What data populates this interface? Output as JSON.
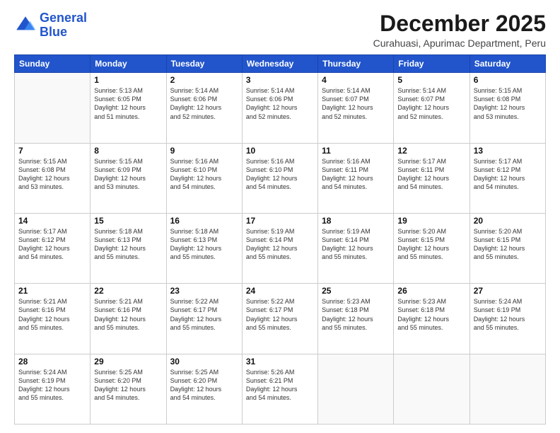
{
  "logo": {
    "line1": "General",
    "line2": "Blue"
  },
  "header": {
    "month_title": "December 2025",
    "subtitle": "Curahuasi, Apurimac Department, Peru"
  },
  "weekdays": [
    "Sunday",
    "Monday",
    "Tuesday",
    "Wednesday",
    "Thursday",
    "Friday",
    "Saturday"
  ],
  "weeks": [
    [
      {
        "day": "",
        "info": ""
      },
      {
        "day": "1",
        "info": "Sunrise: 5:13 AM\nSunset: 6:05 PM\nDaylight: 12 hours\nand 51 minutes."
      },
      {
        "day": "2",
        "info": "Sunrise: 5:14 AM\nSunset: 6:06 PM\nDaylight: 12 hours\nand 52 minutes."
      },
      {
        "day": "3",
        "info": "Sunrise: 5:14 AM\nSunset: 6:06 PM\nDaylight: 12 hours\nand 52 minutes."
      },
      {
        "day": "4",
        "info": "Sunrise: 5:14 AM\nSunset: 6:07 PM\nDaylight: 12 hours\nand 52 minutes."
      },
      {
        "day": "5",
        "info": "Sunrise: 5:14 AM\nSunset: 6:07 PM\nDaylight: 12 hours\nand 52 minutes."
      },
      {
        "day": "6",
        "info": "Sunrise: 5:15 AM\nSunset: 6:08 PM\nDaylight: 12 hours\nand 53 minutes."
      }
    ],
    [
      {
        "day": "7",
        "info": "Sunrise: 5:15 AM\nSunset: 6:08 PM\nDaylight: 12 hours\nand 53 minutes."
      },
      {
        "day": "8",
        "info": "Sunrise: 5:15 AM\nSunset: 6:09 PM\nDaylight: 12 hours\nand 53 minutes."
      },
      {
        "day": "9",
        "info": "Sunrise: 5:16 AM\nSunset: 6:10 PM\nDaylight: 12 hours\nand 54 minutes."
      },
      {
        "day": "10",
        "info": "Sunrise: 5:16 AM\nSunset: 6:10 PM\nDaylight: 12 hours\nand 54 minutes."
      },
      {
        "day": "11",
        "info": "Sunrise: 5:16 AM\nSunset: 6:11 PM\nDaylight: 12 hours\nand 54 minutes."
      },
      {
        "day": "12",
        "info": "Sunrise: 5:17 AM\nSunset: 6:11 PM\nDaylight: 12 hours\nand 54 minutes."
      },
      {
        "day": "13",
        "info": "Sunrise: 5:17 AM\nSunset: 6:12 PM\nDaylight: 12 hours\nand 54 minutes."
      }
    ],
    [
      {
        "day": "14",
        "info": "Sunrise: 5:17 AM\nSunset: 6:12 PM\nDaylight: 12 hours\nand 54 minutes."
      },
      {
        "day": "15",
        "info": "Sunrise: 5:18 AM\nSunset: 6:13 PM\nDaylight: 12 hours\nand 55 minutes."
      },
      {
        "day": "16",
        "info": "Sunrise: 5:18 AM\nSunset: 6:13 PM\nDaylight: 12 hours\nand 55 minutes."
      },
      {
        "day": "17",
        "info": "Sunrise: 5:19 AM\nSunset: 6:14 PM\nDaylight: 12 hours\nand 55 minutes."
      },
      {
        "day": "18",
        "info": "Sunrise: 5:19 AM\nSunset: 6:14 PM\nDaylight: 12 hours\nand 55 minutes."
      },
      {
        "day": "19",
        "info": "Sunrise: 5:20 AM\nSunset: 6:15 PM\nDaylight: 12 hours\nand 55 minutes."
      },
      {
        "day": "20",
        "info": "Sunrise: 5:20 AM\nSunset: 6:15 PM\nDaylight: 12 hours\nand 55 minutes."
      }
    ],
    [
      {
        "day": "21",
        "info": "Sunrise: 5:21 AM\nSunset: 6:16 PM\nDaylight: 12 hours\nand 55 minutes."
      },
      {
        "day": "22",
        "info": "Sunrise: 5:21 AM\nSunset: 6:16 PM\nDaylight: 12 hours\nand 55 minutes."
      },
      {
        "day": "23",
        "info": "Sunrise: 5:22 AM\nSunset: 6:17 PM\nDaylight: 12 hours\nand 55 minutes."
      },
      {
        "day": "24",
        "info": "Sunrise: 5:22 AM\nSunset: 6:17 PM\nDaylight: 12 hours\nand 55 minutes."
      },
      {
        "day": "25",
        "info": "Sunrise: 5:23 AM\nSunset: 6:18 PM\nDaylight: 12 hours\nand 55 minutes."
      },
      {
        "day": "26",
        "info": "Sunrise: 5:23 AM\nSunset: 6:18 PM\nDaylight: 12 hours\nand 55 minutes."
      },
      {
        "day": "27",
        "info": "Sunrise: 5:24 AM\nSunset: 6:19 PM\nDaylight: 12 hours\nand 55 minutes."
      }
    ],
    [
      {
        "day": "28",
        "info": "Sunrise: 5:24 AM\nSunset: 6:19 PM\nDaylight: 12 hours\nand 55 minutes."
      },
      {
        "day": "29",
        "info": "Sunrise: 5:25 AM\nSunset: 6:20 PM\nDaylight: 12 hours\nand 54 minutes."
      },
      {
        "day": "30",
        "info": "Sunrise: 5:25 AM\nSunset: 6:20 PM\nDaylight: 12 hours\nand 54 minutes."
      },
      {
        "day": "31",
        "info": "Sunrise: 5:26 AM\nSunset: 6:21 PM\nDaylight: 12 hours\nand 54 minutes."
      },
      {
        "day": "",
        "info": ""
      },
      {
        "day": "",
        "info": ""
      },
      {
        "day": "",
        "info": ""
      }
    ]
  ]
}
